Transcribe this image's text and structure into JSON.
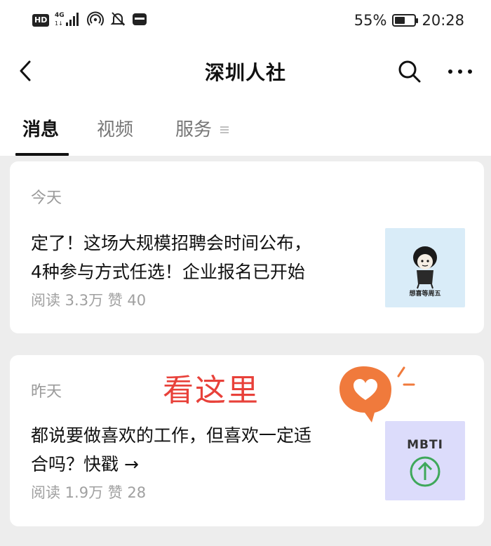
{
  "status_bar": {
    "hd": "HD",
    "network": "4G",
    "battery": "55%",
    "battery_level": 0.55,
    "time": "20:28"
  },
  "nav": {
    "title": "深圳人社",
    "icons": [
      "back-icon",
      "search-icon",
      "more-icon"
    ]
  },
  "tabs": [
    {
      "label": "消息",
      "active": true
    },
    {
      "label": "视频",
      "active": false
    },
    {
      "label": "服务",
      "active": false
    }
  ],
  "articles": [
    {
      "day": "今天",
      "title_line1": "定了！这场大规模招聘会时间公布，",
      "title_line2": "4种参与方式任选！企业报名已开始",
      "meta": "阅读 3.3万  赞 40",
      "thumb_caption": "想喜等周五"
    },
    {
      "day": "昨天",
      "title_line1": "都说要做喜欢的工作，但喜欢一定适",
      "title_line2": "合吗？快戳 →",
      "meta": "阅读 1.9万  赞 28",
      "thumb_text": "MBTI"
    }
  ],
  "overlay": {
    "text": "看这里"
  },
  "colors": {
    "accent": "#e8413a",
    "heart": "#f07a3c",
    "mbti_green": "#3fa85b",
    "background": "#ededed"
  }
}
